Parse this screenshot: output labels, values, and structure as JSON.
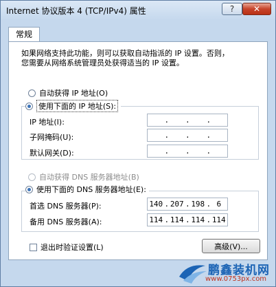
{
  "window": {
    "title": "Internet 协议版本 4 (TCP/IPv4) 属性",
    "help_label": "?",
    "close_label": "✕"
  },
  "tabs": [
    {
      "label": "常规"
    }
  ],
  "description": [
    "如果网络支持此功能，则可以获取自动指派的 IP 设置。否则，",
    "您需要从网络系统管理员处获得适当的 IP 设置。"
  ],
  "ip_section": {
    "auto_label": "自动获得 IP 地址(O)",
    "manual_label": "使用下面的 IP 地址(S):",
    "selected": "manual",
    "fields": [
      {
        "label": "IP 地址(I):",
        "value": [
          "",
          "",
          "",
          ""
        ]
      },
      {
        "label": "子网掩码(U):",
        "value": [
          "",
          "",
          "",
          ""
        ]
      },
      {
        "label": "默认网关(D):",
        "value": [
          "",
          "",
          "",
          ""
        ]
      }
    ]
  },
  "dns_section": {
    "auto_label": "自动获得 DNS 服务器地址(B)",
    "manual_label": "使用下面的 DNS 服务器地址(E):",
    "selected": "manual",
    "fields": [
      {
        "label": "首选 DNS 服务器(P):",
        "value": [
          "140",
          "207",
          "198",
          "6"
        ]
      },
      {
        "label": "备用 DNS 服务器(A):",
        "value": [
          "114",
          "114",
          "114",
          "114"
        ]
      }
    ]
  },
  "validate_label": "退出时验证设置(L)",
  "advanced_label": "高级(V)...",
  "watermark": {
    "name": "鹏鑫装机网",
    "url": "www.0753px.com"
  },
  "colors": {
    "accent": "#3c74b8",
    "close_button": "#c7442b",
    "watermark_blue": "#1c64b5",
    "watermark_red": "#c0321d"
  }
}
